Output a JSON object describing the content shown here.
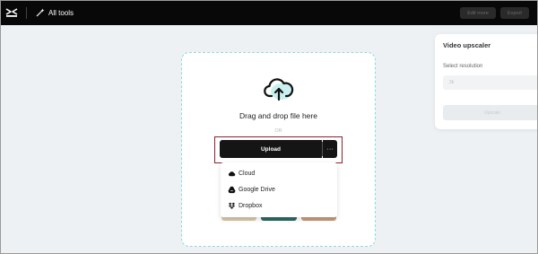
{
  "header": {
    "all_tools_label": "All tools",
    "edit_more_label": "Edit more",
    "export_label": "Export"
  },
  "upscaler_panel": {
    "title": "Video upscaler",
    "select_resolution_label": "Select resolution",
    "resolution_value": "2k",
    "action_label": "Upscale"
  },
  "upload_area": {
    "drag_text": "Drag and drop file here",
    "or_text": "OR",
    "upload_label": "Upload",
    "more_label": "···"
  },
  "upload_menu": {
    "items": [
      {
        "label": "Cloud",
        "icon": "cloud-icon"
      },
      {
        "label": "Google Drive",
        "icon": "google-drive-icon"
      },
      {
        "label": "Dropbox",
        "icon": "dropbox-icon"
      }
    ]
  },
  "colors": {
    "topbar": "#080808",
    "dropzone_border": "#8ed9dc",
    "upload_button": "#151515",
    "highlight_box": "#8d1f2c"
  }
}
